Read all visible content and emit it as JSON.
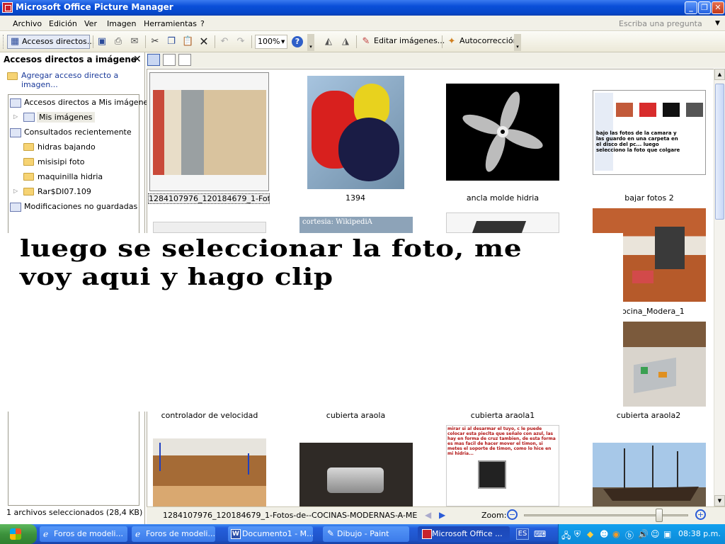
{
  "window": {
    "title": "Microsoft Office Picture Manager"
  },
  "menu": {
    "items": [
      "Archivo",
      "Edición",
      "Ver",
      "Imagen",
      "Herramientas",
      "?"
    ],
    "ask_placeholder": "Escriba una pregunta"
  },
  "toolbar": {
    "shortcuts_label": "Accesos directos...",
    "zoom_value": "100%",
    "edit_images_label": "Editar imágenes...",
    "autocorrect_label": "Autocorrección"
  },
  "sidebar": {
    "title": "Accesos directos a imágene",
    "add_shortcut": "Agregar acceso directo a imagen...",
    "tree": [
      "Accesos directos a Mis imágenes",
      "Mis imágenes",
      "Consultados recientemente",
      "hidras bajando",
      "misisipi foto",
      "maquinilla hidria",
      "Rar$DI07.109",
      "Modificaciones no guardadas"
    ]
  },
  "status": {
    "selection": "1 archivos seleccionados (28,4 KB)",
    "filename": "1284107976_120184679_1-Fotos-de--COCINAS-MODERNAS-A-ME...",
    "zoom_label": "Zoom:"
  },
  "thumbnails": [
    {
      "caption": "1284107976_120184679_1-Foto..."
    },
    {
      "caption": "1394"
    },
    {
      "caption": "ancla molde hidria"
    },
    {
      "caption": "bajar fotos 2"
    },
    {
      "caption": "ocina_Modera_1"
    },
    {
      "caption": "controlador de velocidad"
    },
    {
      "caption": "cubierta araola"
    },
    {
      "caption": "cubierta araola1"
    },
    {
      "caption": "cubierta araola2"
    }
  ],
  "thumb_text": {
    "wiki": "cortesia: WikipediA",
    "bajar": "bajo las fotos de la camara y las guardo en una carpeta en el disco del pc... luego selecciono la foto que colgare",
    "servo": "mirar si al desarmar el tuyo, c le puede colocar esta pieclta que señalo con azul, las hay en forma de cruz tambien, de esta forma es mas facil de hacer mover el timon, si metes el soporte de timon, como lo hice en mi hidria..."
  },
  "annotation": {
    "text_line1": "luego se seleccionar la foto, me",
    "text_line2": "voy aqui y hago clip"
  },
  "taskbar": {
    "tasks": [
      "Foros de modeli...",
      "Foros de modeli...",
      "Documento1 - M...",
      "Dibujo - Paint",
      "Microsoft Office ..."
    ],
    "lang": "ES",
    "clock": "08:38 p.m."
  }
}
